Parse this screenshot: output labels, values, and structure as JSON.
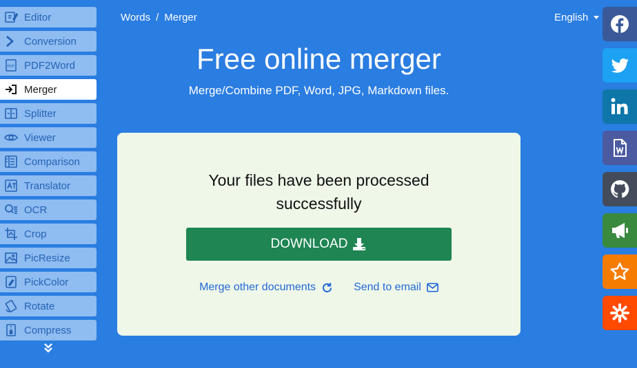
{
  "sidebar": {
    "items": [
      {
        "label": "Editor",
        "icon": "edit-icon"
      },
      {
        "label": "Conversion",
        "icon": "chevron-right-icon"
      },
      {
        "label": "PDF2Word",
        "icon": "pdf-icon"
      },
      {
        "label": "Merger",
        "icon": "merge-icon",
        "active": true
      },
      {
        "label": "Splitter",
        "icon": "split-icon"
      },
      {
        "label": "Viewer",
        "icon": "eye-icon"
      },
      {
        "label": "Comparison",
        "icon": "compare-icon"
      },
      {
        "label": "Translator",
        "icon": "translate-icon"
      },
      {
        "label": "OCR",
        "icon": "ocr-icon"
      },
      {
        "label": "Crop",
        "icon": "crop-icon"
      },
      {
        "label": "PicResize",
        "icon": "picture-icon"
      },
      {
        "label": "PickColor",
        "icon": "color-picker-icon"
      },
      {
        "label": "Rotate",
        "icon": "rotate-icon"
      },
      {
        "label": "Compress",
        "icon": "compress-icon"
      }
    ],
    "more_icon": "double-chevron-down-icon"
  },
  "header": {
    "breadcrumb": [
      "Words",
      "Merger"
    ],
    "language": "English"
  },
  "hero": {
    "title": "Free online merger",
    "subtitle": "Merge/Combine PDF, Word, JPG, Markdown files."
  },
  "result": {
    "message_line1": "Your files have been processed",
    "message_line2": "successfully",
    "download_label": "DOWNLOAD",
    "merge_other_label": "Merge other documents",
    "send_email_label": "Send to email"
  },
  "social": [
    {
      "name": "facebook-icon",
      "color": "#3b5998"
    },
    {
      "name": "twitter-icon",
      "color": "#1da1f2"
    },
    {
      "name": "linkedin-icon",
      "color": "#0e76a8"
    },
    {
      "name": "word-document-icon",
      "color": "#4b5aa1"
    },
    {
      "name": "github-icon",
      "color": "#444c5c"
    },
    {
      "name": "megaphone-icon",
      "color": "#39893e"
    },
    {
      "name": "star-icon",
      "color": "#f57c00"
    },
    {
      "name": "asterisk-icon",
      "color": "#ff4a00"
    }
  ],
  "colors": {
    "background": "#2a7de1",
    "sidebar_item": "#8fbcf1",
    "card": "#eef7e8",
    "download": "#1e8553",
    "link": "#2369d6"
  }
}
